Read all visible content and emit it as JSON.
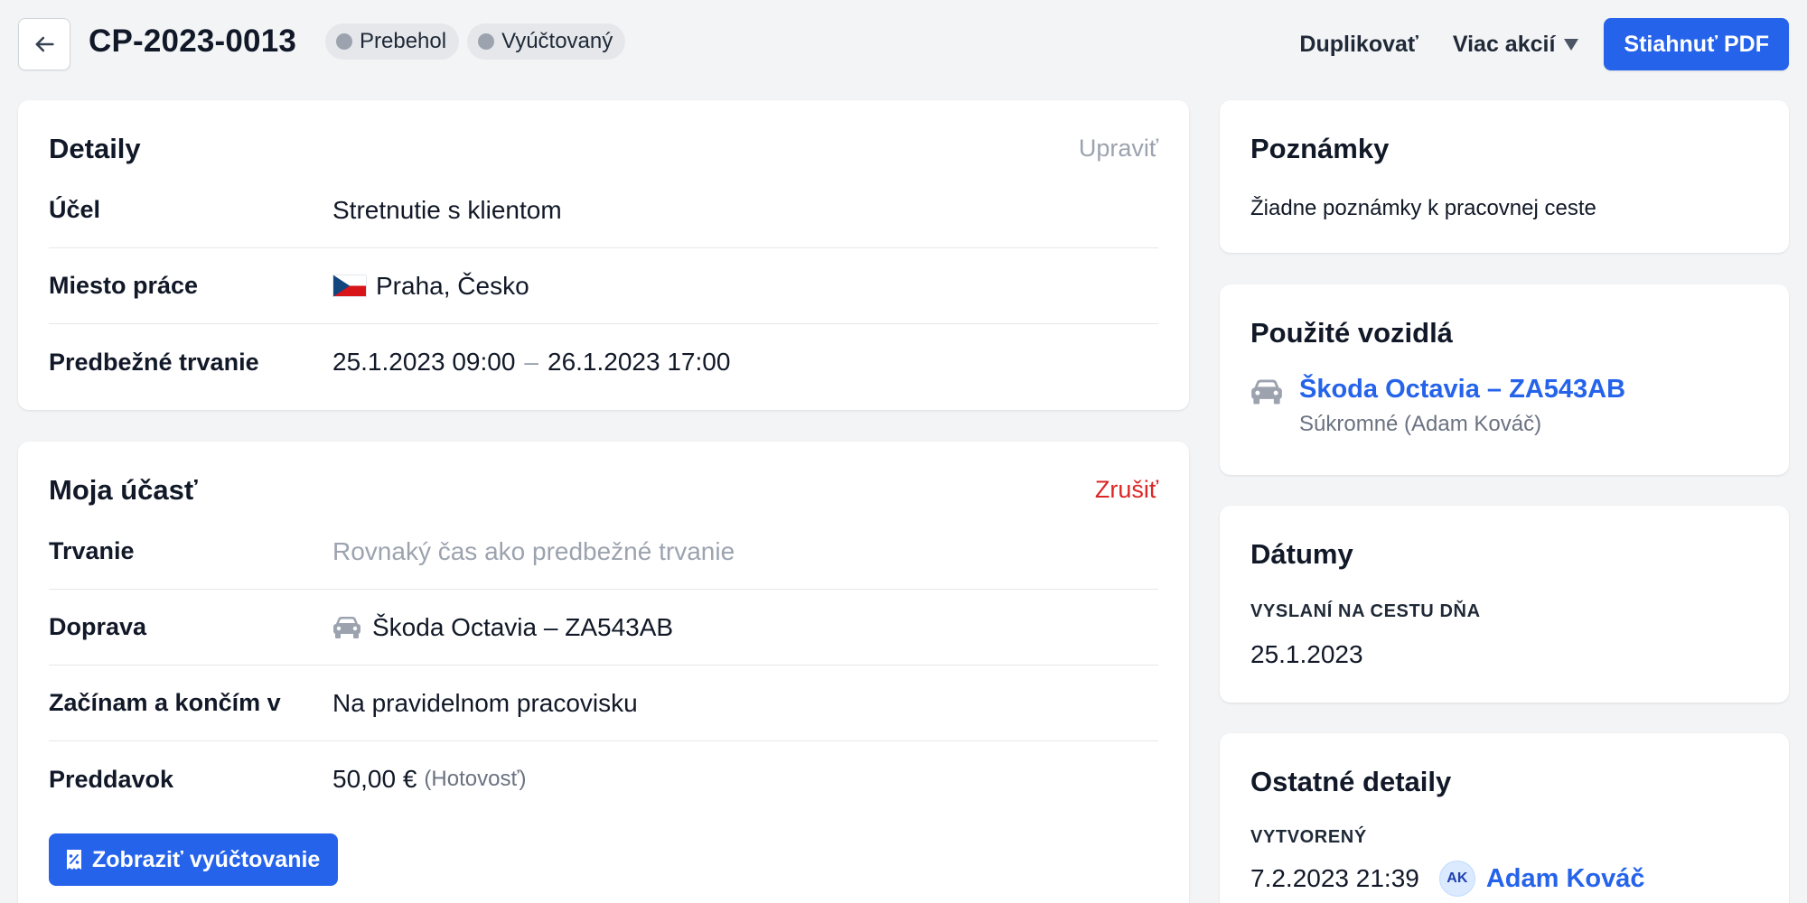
{
  "header": {
    "title": "CP-2023-0013",
    "badges": [
      "Prebehol",
      "Vyúčtovaný"
    ],
    "duplicate_label": "Duplikovať",
    "more_actions_label": "Viac akcií",
    "download_pdf_label": "Stiahnuť PDF"
  },
  "details": {
    "title": "Detaily",
    "edit_label": "Upraviť",
    "rows": [
      {
        "label": "Účel",
        "value": "Stretnutie s klientom"
      },
      {
        "label": "Miesto práce",
        "value": "Praha, Česko",
        "flag": "cz-flag-icon"
      },
      {
        "label": "Predbežné trvanie",
        "value_start": "25.1.2023 09:00",
        "separator": "–",
        "value_end": "26.1.2023 17:00"
      }
    ]
  },
  "participation": {
    "title": "Moja účasť",
    "cancel_label": "Zrušiť",
    "rows": [
      {
        "label": "Trvanie",
        "value": "Rovnaký čas ako predbežné trvanie"
      },
      {
        "label": "Doprava",
        "value": "Škoda Octavia – ZA543AB",
        "icon": "car-icon"
      },
      {
        "label": "Začínam a končím v",
        "value": "Na pravidelnom pracovisku"
      },
      {
        "label": "Preddavok",
        "value": "50,00 €",
        "note": "(Hotovosť)"
      }
    ],
    "settlement_button_label": "Zobraziť vyúčtovanie"
  },
  "notes": {
    "title": "Poznámky",
    "empty_text": "Žiadne poznámky k pracovnej ceste"
  },
  "vehicles": {
    "title": "Použité vozidlá",
    "items": [
      {
        "name": "Škoda Octavia – ZA543AB",
        "subtitle": "Súkromné (Adam Kováč)",
        "icon": "car-icon"
      }
    ]
  },
  "dates": {
    "title": "Dátumy",
    "sent_label": "VYSLANÍ NA CESTU DŇA",
    "sent_value": "25.1.2023"
  },
  "other": {
    "title": "Ostatné detaily",
    "created_label": "VYTVORENÝ",
    "created_date": "7.2.2023 21:39",
    "creator_initials": "AK",
    "creator_name": "Adam Kováč"
  },
  "colors": {
    "primary": "#2563eb",
    "danger": "#dc2626",
    "background": "#f3f4f6",
    "badge_bg": "#e5e7eb"
  }
}
